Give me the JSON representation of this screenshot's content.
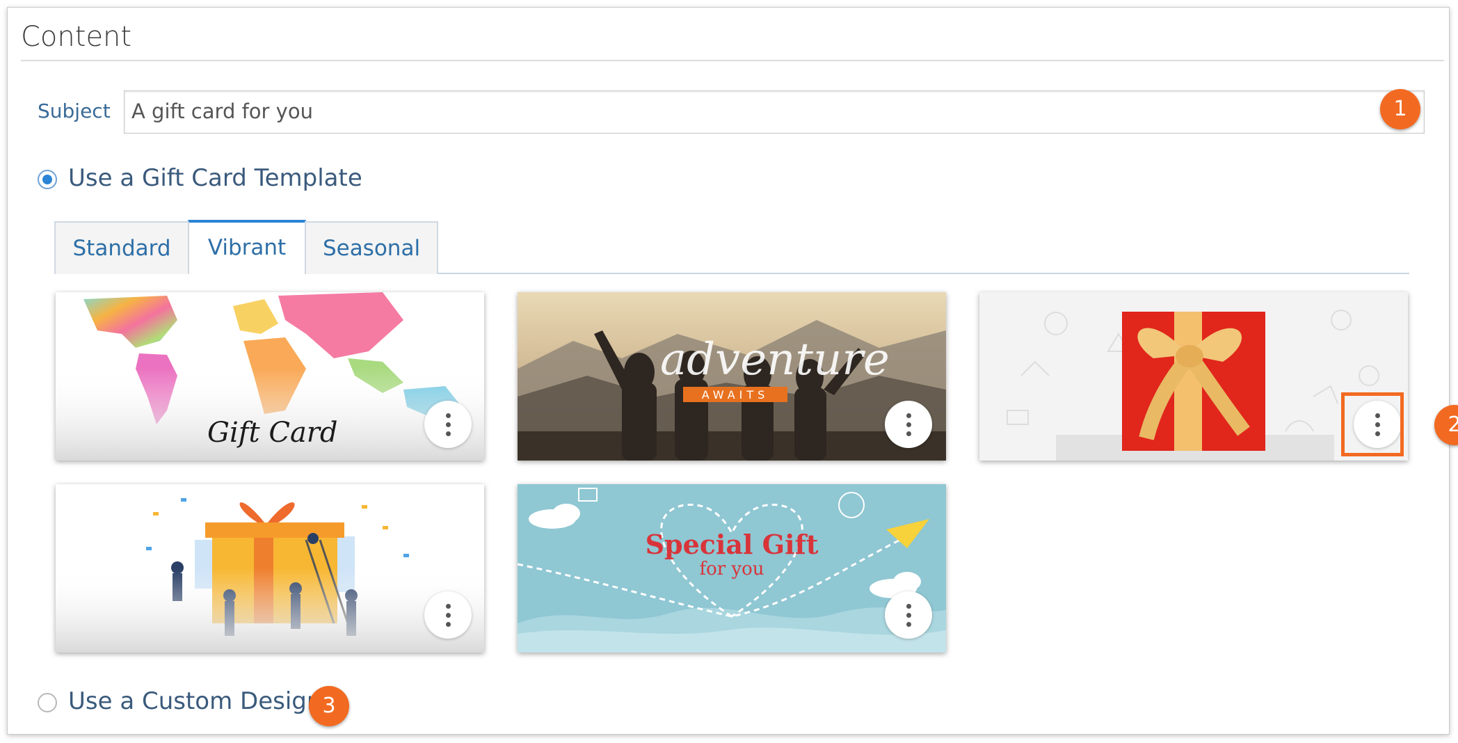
{
  "section": {
    "title": "Content"
  },
  "subject": {
    "label": "Subject",
    "value": "A gift card for you"
  },
  "options": {
    "template_label": "Use a Gift Card Template",
    "template_selected": true,
    "custom_label": "Use a Custom Design",
    "custom_selected": false
  },
  "tabs": [
    {
      "label": "Standard",
      "active": false
    },
    {
      "label": "Vibrant",
      "active": true
    },
    {
      "label": "Seasonal",
      "active": false
    }
  ],
  "cards": [
    {
      "name": "world-map-gift-card",
      "caption": "Gift Card"
    },
    {
      "name": "adventure-awaits-card",
      "caption": "adventure",
      "subcaption": "AWAITS"
    },
    {
      "name": "red-gift-box-card"
    },
    {
      "name": "celebration-gift-card"
    },
    {
      "name": "special-gift-card",
      "caption": "Special Gift",
      "subcaption": "for you"
    }
  ],
  "callouts": [
    "1",
    "2",
    "3"
  ],
  "colors": {
    "accent": "#2b84d5",
    "callout": "#f26a21",
    "label": "#3a6b98"
  }
}
